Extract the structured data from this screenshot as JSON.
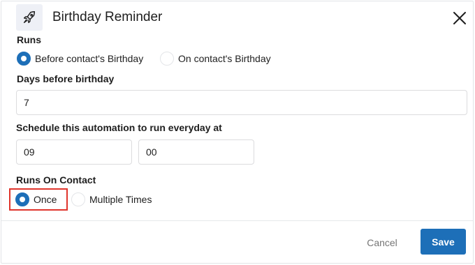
{
  "header": {
    "title": "Birthday Reminder",
    "icon": "rocket-icon",
    "close_icon": "close-icon"
  },
  "runs": {
    "label": "Runs",
    "options": [
      {
        "label": "Before contact's Birthday",
        "selected": true
      },
      {
        "label": "On contact's Birthday",
        "selected": false
      }
    ]
  },
  "days_before": {
    "label": "Days before birthday",
    "value": "7"
  },
  "schedule": {
    "label": "Schedule this automation to run everyday at",
    "hour": "09",
    "minute": "00"
  },
  "runs_on_contact": {
    "label": "Runs On Contact",
    "options": [
      {
        "label": "Once",
        "selected": true
      },
      {
        "label": "Multiple Times",
        "selected": false
      }
    ]
  },
  "footer": {
    "cancel_label": "Cancel",
    "save_label": "Save"
  },
  "colors": {
    "accent": "#1d6fb8",
    "highlight": "#e0352c"
  }
}
